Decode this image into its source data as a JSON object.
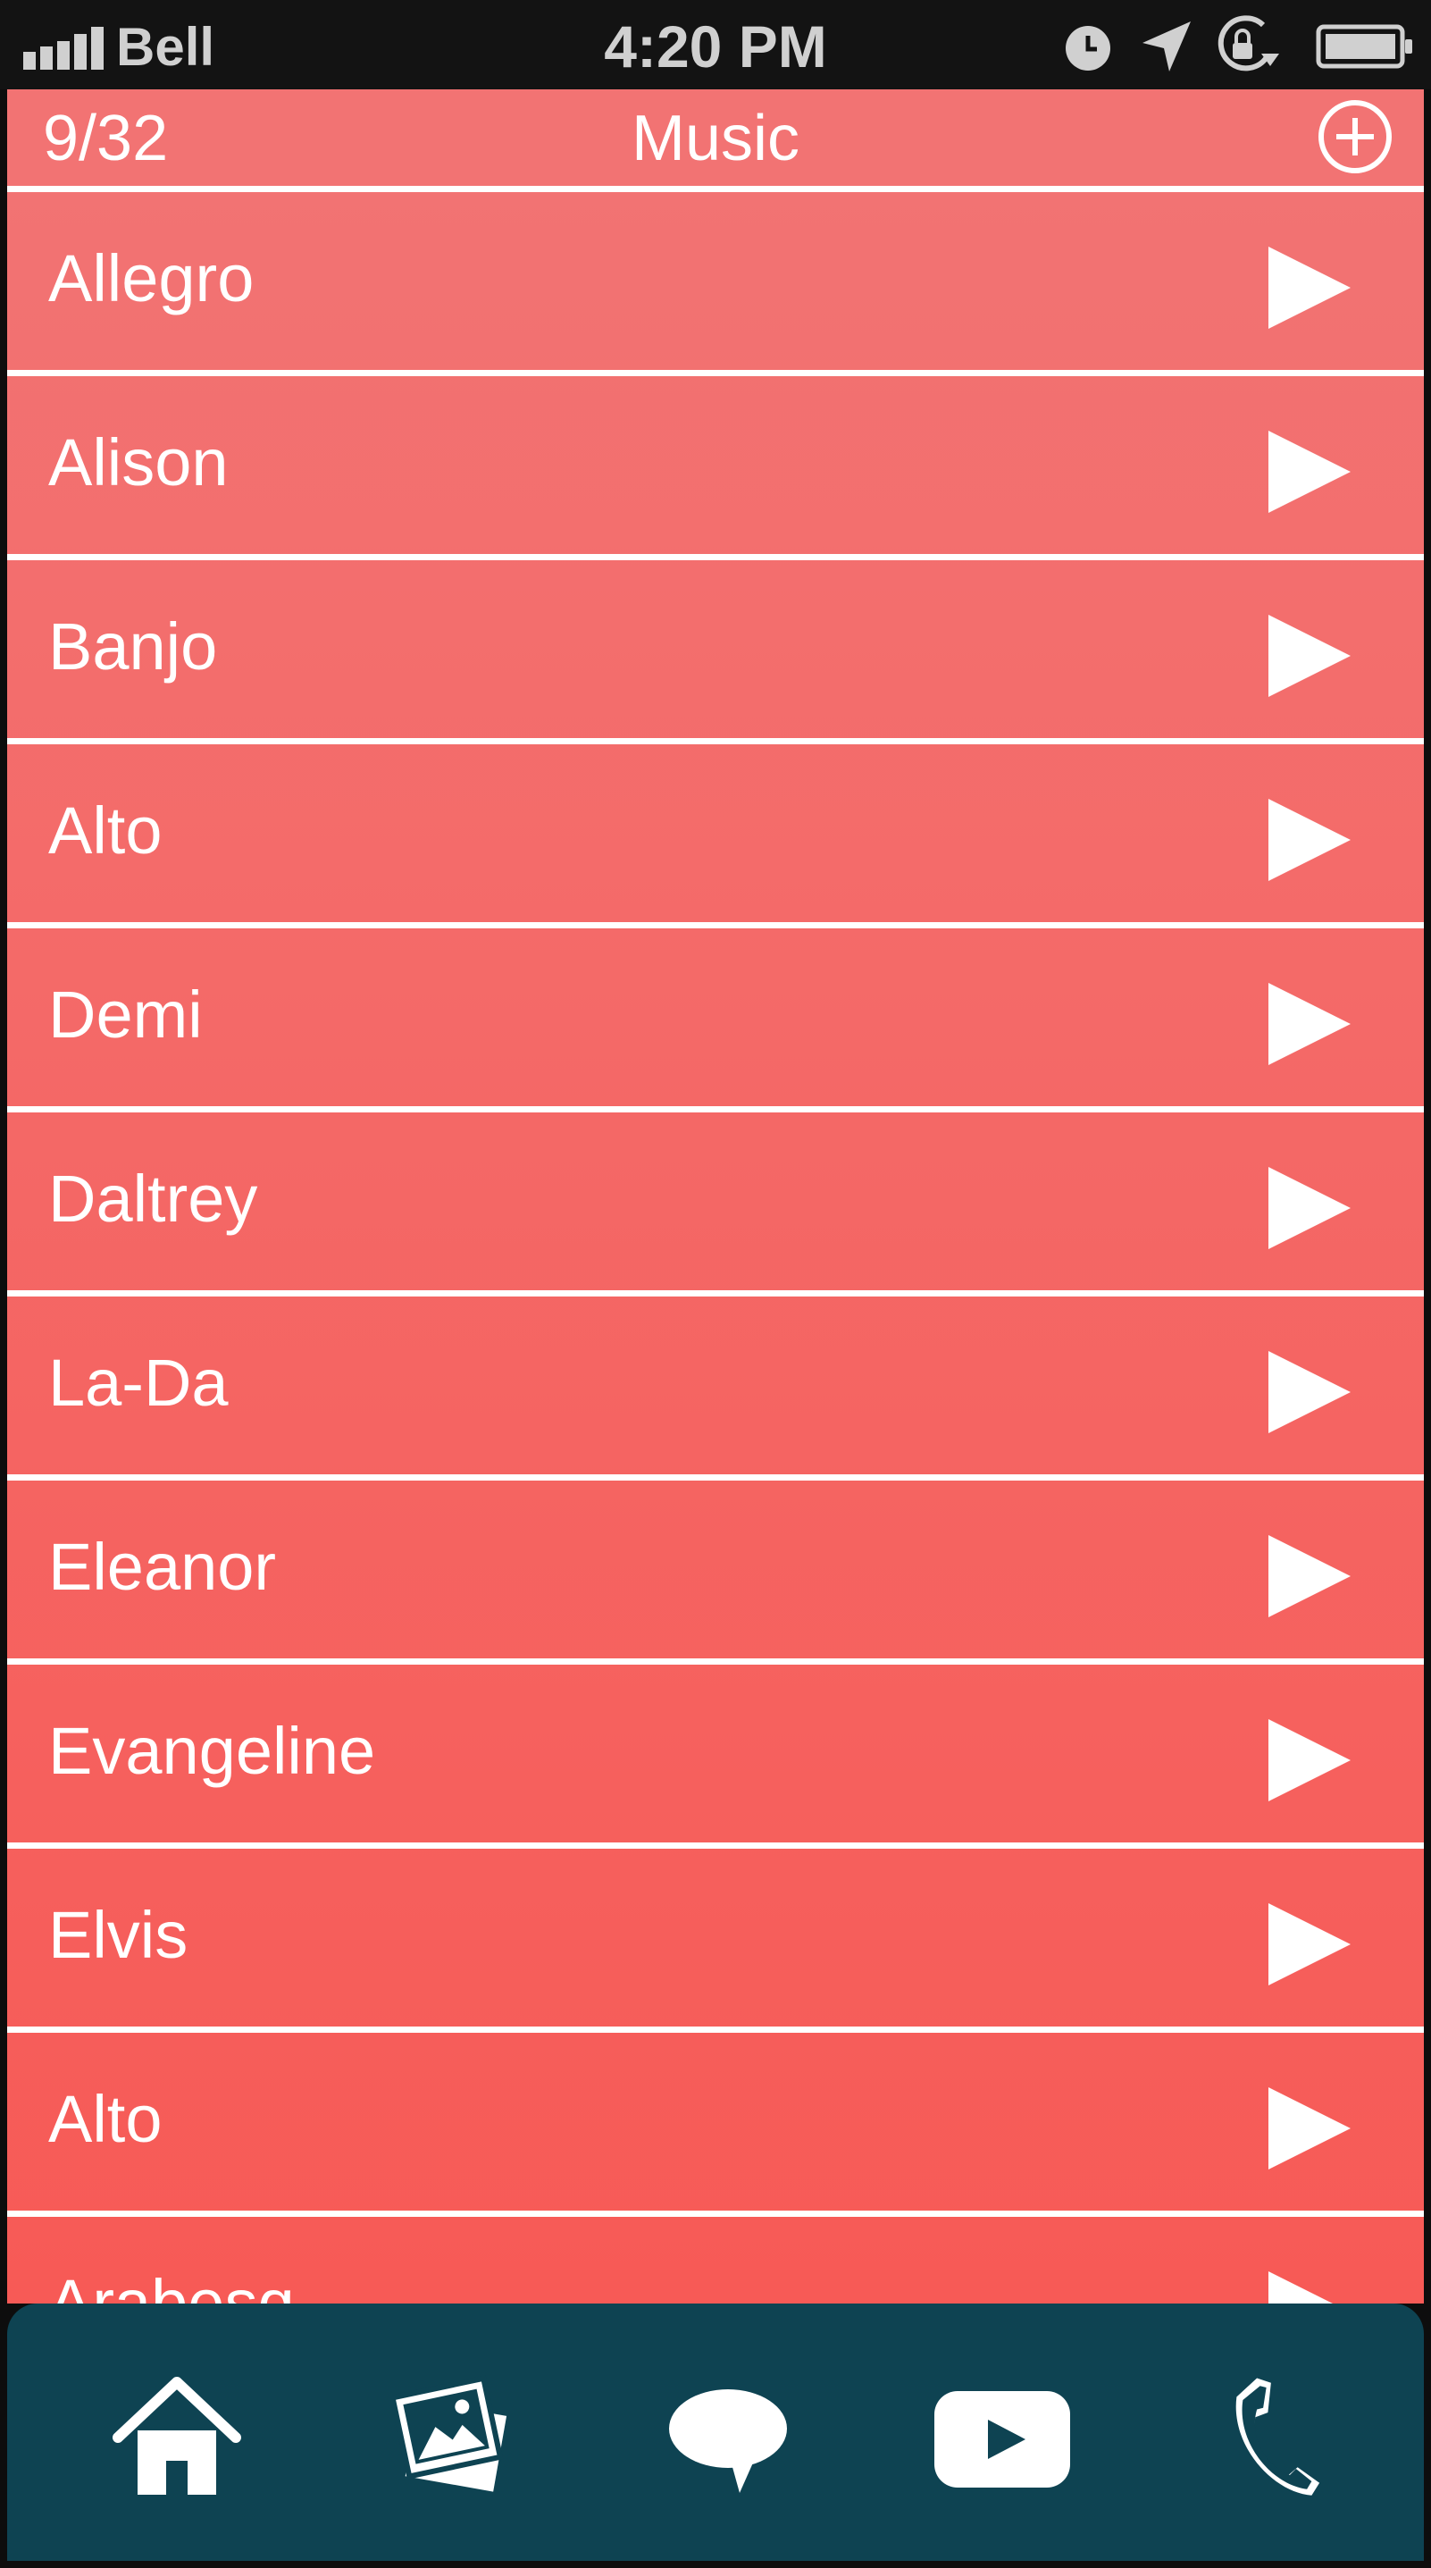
{
  "status_bar": {
    "carrier": "Bell",
    "time": "4:20 PM",
    "icons": [
      "signal-icon",
      "alarm-icon",
      "location-icon",
      "rotation-lock-icon",
      "battery-icon"
    ]
  },
  "header": {
    "count": "9/32",
    "title": "Music",
    "add_icon": "plus-circle-icon"
  },
  "tracks": [
    {
      "name": "Allegro"
    },
    {
      "name": "Alison"
    },
    {
      "name": "Banjo"
    },
    {
      "name": "Alto"
    },
    {
      "name": "Demi"
    },
    {
      "name": "Daltrey"
    },
    {
      "name": "La-Da"
    },
    {
      "name": "Eleanor"
    },
    {
      "name": "Evangeline"
    },
    {
      "name": "Elvis"
    },
    {
      "name": "Alto"
    },
    {
      "name": "Arabesq"
    }
  ],
  "tab_bar": {
    "tabs": [
      "home-icon",
      "photos-icon",
      "chat-icon",
      "video-play-icon",
      "phone-icon"
    ]
  },
  "colors": {
    "header": "#f27373",
    "list_top": "#f27373",
    "list_bottom": "#f75a56",
    "tab_bar": "#0e4352",
    "status_bar": "#131313",
    "text": "#ffffff"
  }
}
